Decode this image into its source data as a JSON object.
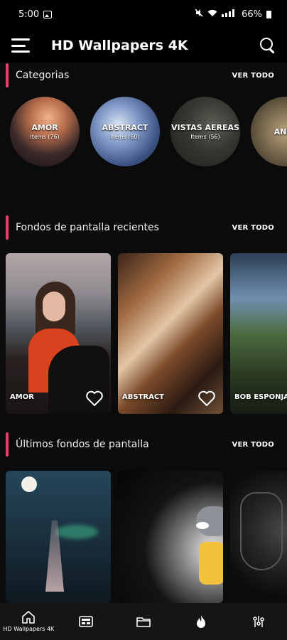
{
  "status_bar": {
    "time": "5:00",
    "battery": "66%"
  },
  "app_bar": {
    "title": "HD Wallpapers 4K"
  },
  "sections": {
    "categories": {
      "title": "Categorias",
      "see_all": "VER TODO"
    },
    "recent": {
      "title": "Fondos de pantalla recientes",
      "see_all": "VER TODO"
    },
    "latest": {
      "title": "Últimos fondos de pantalla",
      "see_all": "VER TODO"
    }
  },
  "categories": [
    {
      "name": "AMOR",
      "count": "Items (76)"
    },
    {
      "name": "ABSTRACT",
      "count": "Items (60)"
    },
    {
      "name": "VISTAS AEREAS",
      "count": "Items (56)"
    },
    {
      "name": "ANIM",
      "count": ""
    }
  ],
  "recent_wallpapers": [
    {
      "label": "AMOR"
    },
    {
      "label": "ABSTRACT"
    },
    {
      "label": "BOB ESPONJA"
    }
  ],
  "bottom_nav": {
    "home_label": "HD Wallpapers 4K"
  },
  "colors": {
    "accent": "#e6416e",
    "background": "#0b0b0b",
    "nav_background": "#151515"
  }
}
